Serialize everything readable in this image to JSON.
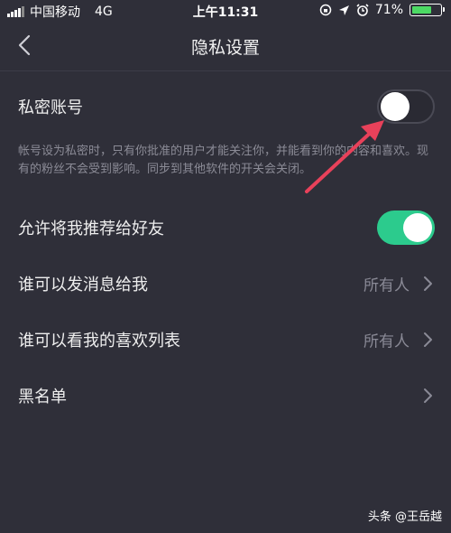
{
  "status_bar": {
    "carrier": "中国移动",
    "network": "4G",
    "time": "上午11:31",
    "battery_percent": "71%",
    "battery_level": 0.71
  },
  "nav": {
    "title": "隐私设置"
  },
  "private_account": {
    "label": "私密账号",
    "enabled": false,
    "description": "帐号设为私密时，只有你批准的用户才能关注你，并能看到你的内容和喜欢。现有的粉丝不会受到影响。同步到其他软件的开关会关闭。"
  },
  "recommend_to_friends": {
    "label": "允许将我推荐给好友",
    "enabled": true
  },
  "who_can_message": {
    "label": "谁可以发消息给我",
    "value": "所有人"
  },
  "who_can_see_likes": {
    "label": "谁可以看我的喜欢列表",
    "value": "所有人"
  },
  "blacklist": {
    "label": "黑名单"
  },
  "watermark": "头条 @王岳越",
  "colors": {
    "background": "#2f2f39",
    "toggle_on": "#2ccb8d",
    "annotation_arrow": "#e8415a"
  }
}
